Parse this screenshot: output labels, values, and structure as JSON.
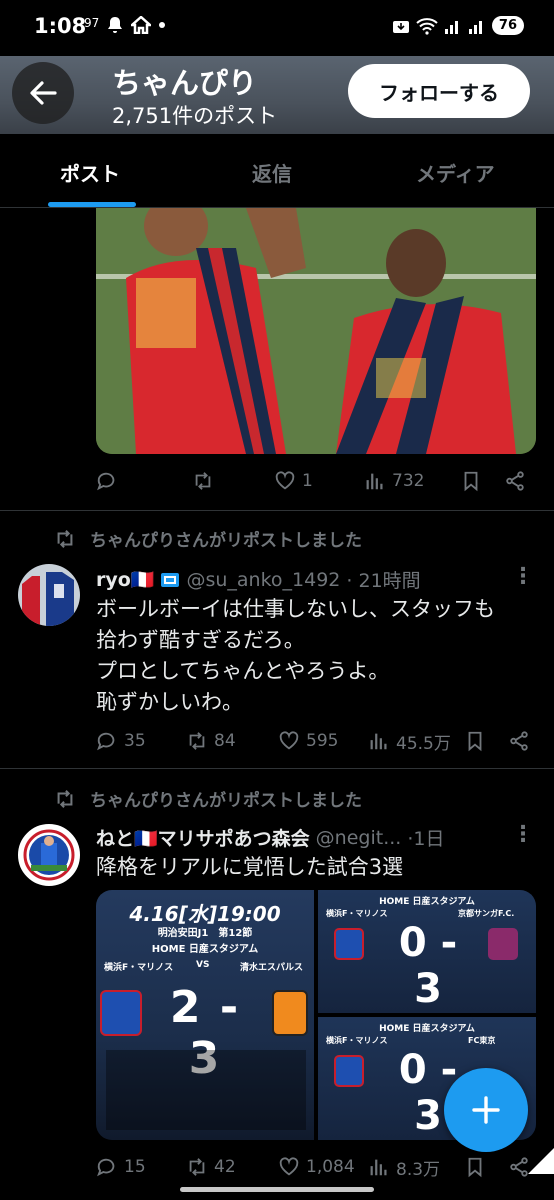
{
  "statusbar": {
    "time": "1:08",
    "signal_text": "97",
    "battery": "76"
  },
  "header": {
    "title": "ちゃんぴり",
    "post_count": "2,751件のポスト",
    "follow_label": "フォローする"
  },
  "tabs": [
    {
      "label": "ポスト"
    },
    {
      "label": "返信"
    },
    {
      "label": "メディア"
    }
  ],
  "tweet1": {
    "replies": "",
    "reposts": "",
    "likes": "1",
    "views": "732"
  },
  "tweet2": {
    "repost_label": "ちゃんぴりさんがリポストしました",
    "name": "ryo🇫🇷",
    "handle": "@su_anko_1492",
    "time": "· 21時間",
    "text": "ボールボーイは仕事しないし、スタッフも\n拾わず酷すぎるだろ。\nプロとしてちゃんとやろうよ。\n恥ずかしいわ。",
    "replies": "35",
    "reposts": "84",
    "likes": "595",
    "views": "45.5万"
  },
  "tweet3": {
    "repost_label": "ちゃんぴりさんがリポストしました",
    "name": "ねと🇫🇷マリサポあつ森会",
    "handle": "@negit...",
    "time": "·1日",
    "text": "降格をリアルに覚悟した試合3選",
    "media": {
      "m1_date": "4.16[水]19:00",
      "m1_league": "明治安田J1　第12節",
      "m1_venue": "HOME 日産スタジアム",
      "m1_home": "横浜F・マリノス",
      "m1_vs": "VS",
      "m1_away": "清水エスパルス",
      "m1_score": "2 - 3",
      "m2_venue": "HOME 日産スタジアム",
      "m2_home": "横浜F・マリノス",
      "m2_away": "京都サンガF.C.",
      "m2_score": "0 - 3",
      "m3_venue": "HOME 日産スタジアム",
      "m3_home": "横浜F・マリノス",
      "m3_away": "FC東京",
      "m3_score": "0 - 3"
    },
    "replies": "15",
    "reposts": "42",
    "likes": "1,084",
    "views": "8.3万"
  }
}
